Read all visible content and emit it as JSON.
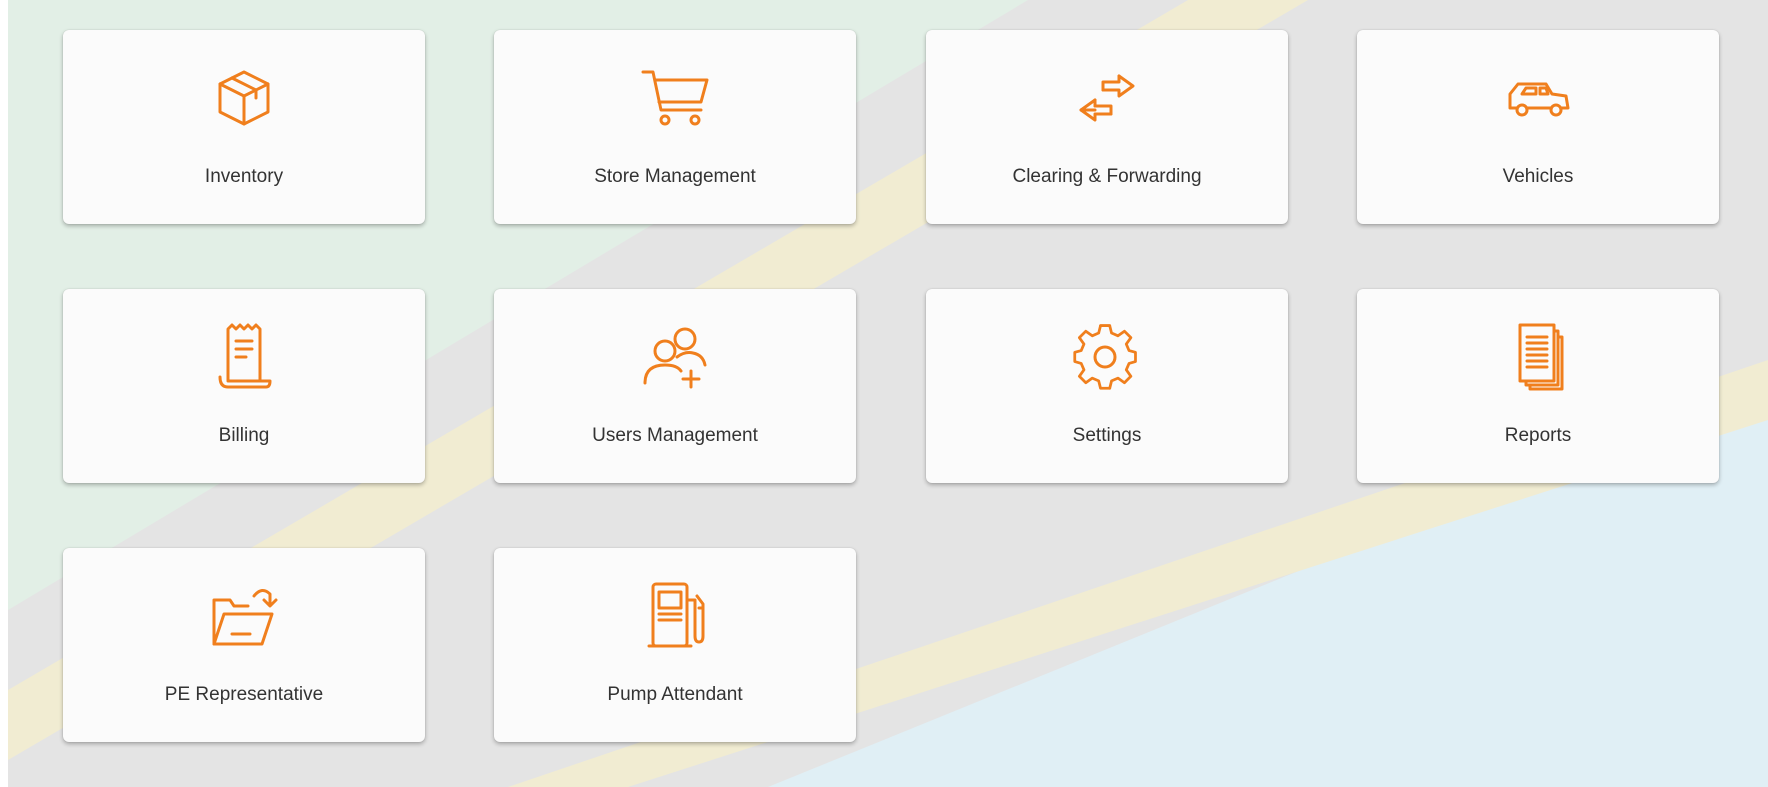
{
  "colors": {
    "accent": "#f07f1d",
    "tile_background": "#fbfbfb",
    "label_text": "#333333",
    "page_background": "#e3e3e3"
  },
  "tiles": [
    {
      "label": "Inventory",
      "icon": "box-icon"
    },
    {
      "label": "Store Management",
      "icon": "shopping-cart-icon"
    },
    {
      "label": "Clearing & Forwarding",
      "icon": "transfer-arrows-icon"
    },
    {
      "label": "Vehicles",
      "icon": "car-icon"
    },
    {
      "label": "Billing",
      "icon": "receipt-icon"
    },
    {
      "label": "Users Management",
      "icon": "add-users-icon"
    },
    {
      "label": "Settings",
      "icon": "gear-icon"
    },
    {
      "label": "Reports",
      "icon": "documents-icon"
    },
    {
      "label": "PE Representative",
      "icon": "folder-open-icon"
    },
    {
      "label": "Pump Attendant",
      "icon": "fuel-pump-icon"
    }
  ]
}
